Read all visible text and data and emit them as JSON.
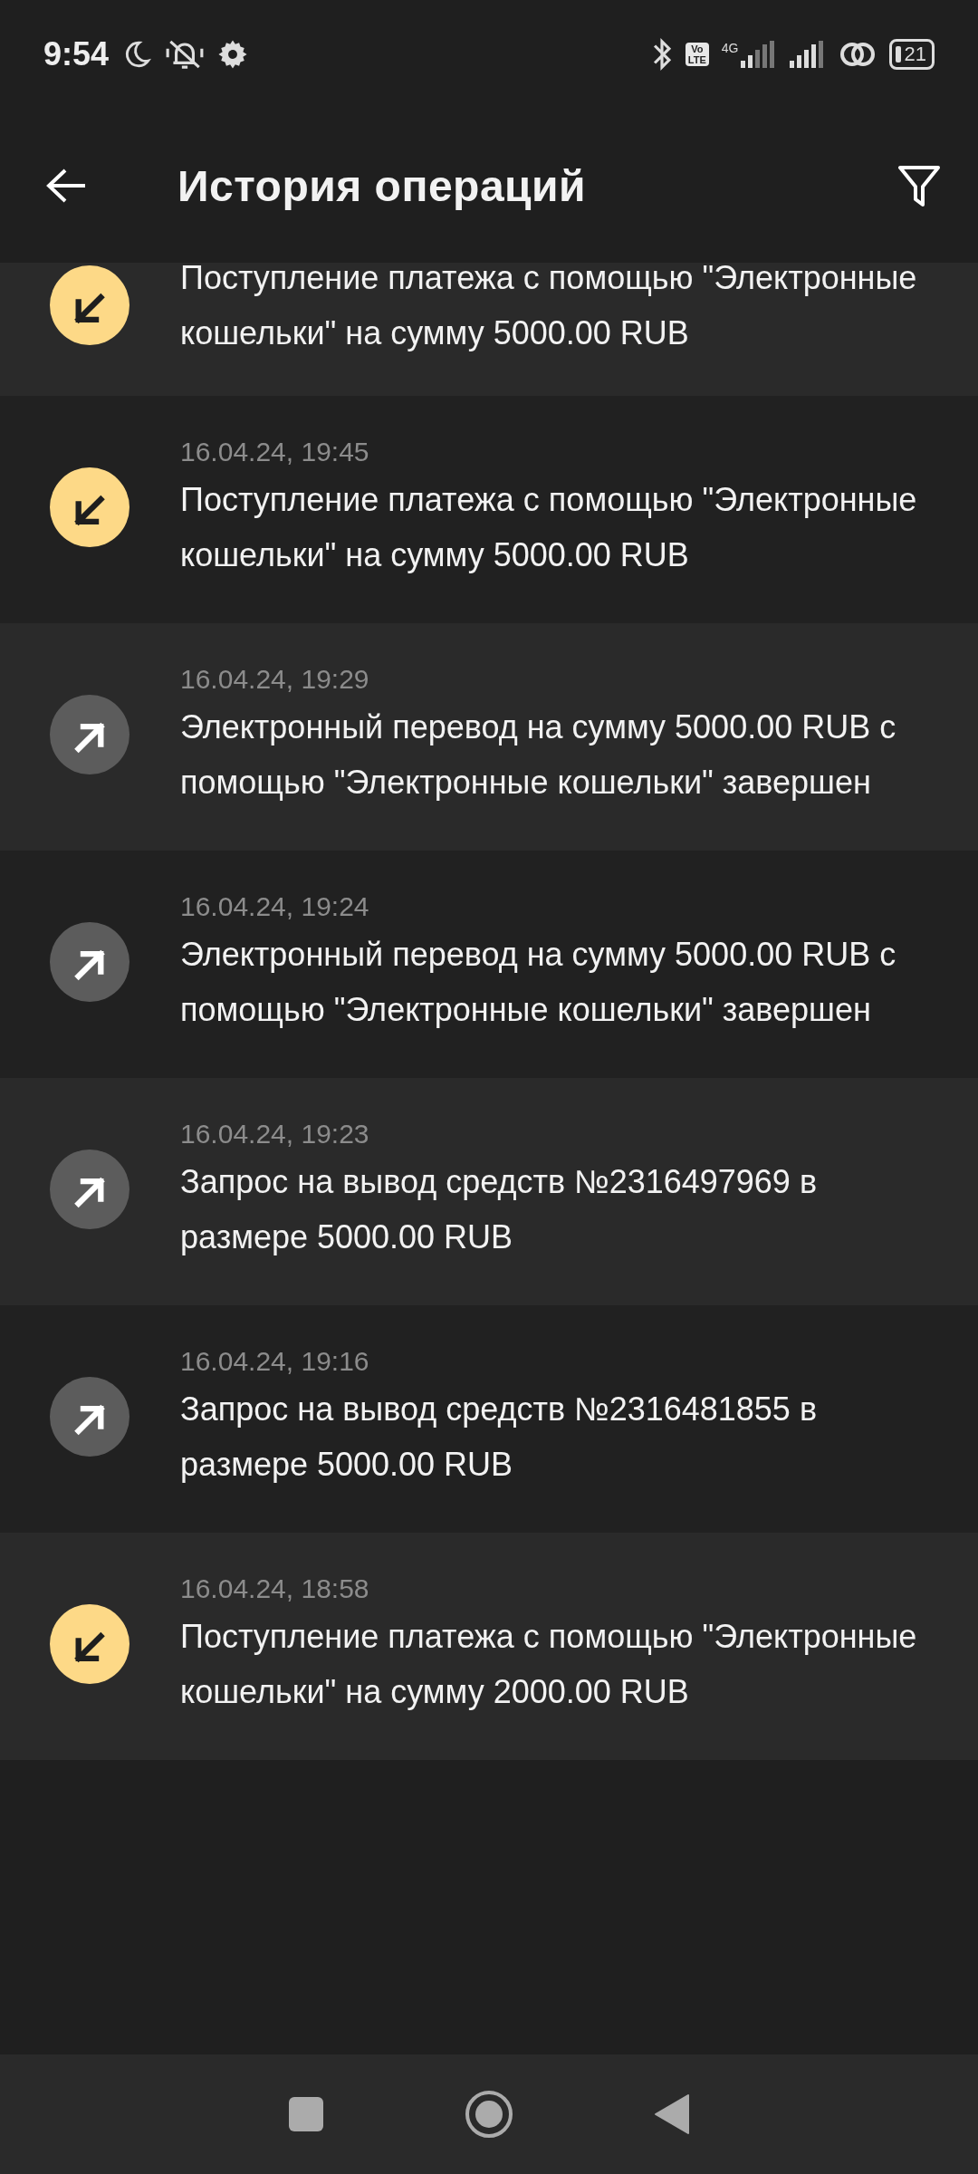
{
  "status_bar": {
    "time": "9:54",
    "volte": [
      "Vo",
      "LTE"
    ],
    "network": "4G",
    "battery": "21"
  },
  "header": {
    "title": "История операций"
  },
  "operations": [
    {
      "kind": "incoming",
      "text": "Поступление платежа с помощью \"Электронные кошельки\" на сумму 5000.00 RUB"
    },
    {
      "kind": "incoming",
      "date": "16.04.24, 19:45",
      "text": "Поступление платежа с помощью \"Электронные кошельки\" на сумму 5000.00 RUB"
    },
    {
      "kind": "outgoing",
      "date": "16.04.24, 19:29",
      "text": "Электронный перевод на сумму 5000.00 RUB с помощью \"Электронные кошельки\" завершен"
    },
    {
      "kind": "outgoing",
      "date": "16.04.24, 19:24",
      "text": "Электронный перевод на сумму 5000.00 RUB с помощью \"Электронные кошельки\" завершен"
    },
    {
      "kind": "outgoing",
      "date": "16.04.24, 19:23",
      "text": "Запрос на вывод средств №2316497969 в размере 5000.00 RUB"
    },
    {
      "kind": "outgoing",
      "date": "16.04.24, 19:16",
      "text": "Запрос на вывод средств №2316481855 в размере 5000.00 RUB"
    },
    {
      "kind": "incoming",
      "date": "16.04.24, 18:58",
      "text": "Поступление платежа с помощью \"Электронные кошельки\" на сумму 2000.00 RUB"
    }
  ]
}
